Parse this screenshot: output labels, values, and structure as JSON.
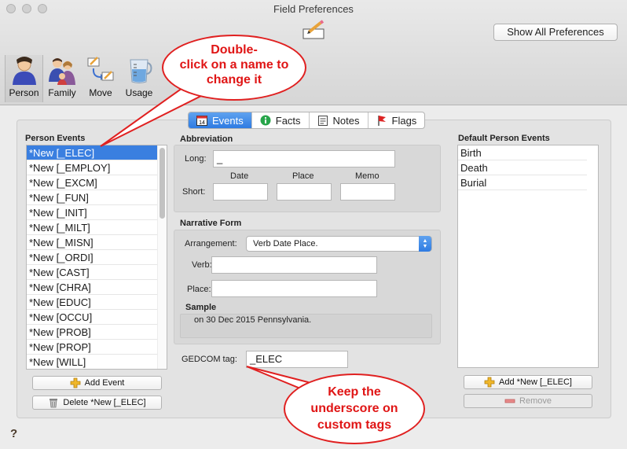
{
  "window": {
    "title": "Field Preferences",
    "show_all_label": "Show All Preferences"
  },
  "toolbar": {
    "items": [
      {
        "label": "Person",
        "icon": "person-icon",
        "selected": true
      },
      {
        "label": "Family",
        "icon": "family-icon",
        "selected": false
      },
      {
        "label": "Move",
        "icon": "move-icon",
        "selected": false
      },
      {
        "label": "Usage",
        "icon": "usage-icon",
        "selected": false
      }
    ]
  },
  "callouts": {
    "top_lines": [
      "Double-",
      "click on a name to",
      "change it"
    ],
    "bottom_lines": [
      "Keep the",
      "underscore on",
      "custom tags"
    ]
  },
  "tabs": [
    {
      "label": "Events",
      "icon": "calendar-icon",
      "active": true
    },
    {
      "label": "Facts",
      "icon": "info-icon",
      "active": false
    },
    {
      "label": "Notes",
      "icon": "notes-icon",
      "active": false
    },
    {
      "label": "Flags",
      "icon": "flag-icon",
      "active": false
    }
  ],
  "person_events": {
    "heading": "Person Events",
    "items": [
      "*New [_ELEC]",
      "*New [_EMPLOY]",
      "*New [_EXCM]",
      "*New [_FUN]",
      "*New [_INIT]",
      "*New [_MILT]",
      "*New [_MISN]",
      "*New [_ORDI]",
      "*New [CAST]",
      "*New [CHRA]",
      "*New [EDUC]",
      "*New [OCCU]",
      "*New [PROB]",
      "*New [PROP]",
      "*New [WILL]"
    ],
    "selected_index": 0,
    "add_label": "Add Event",
    "delete_label": "Delete *New [_ELEC]"
  },
  "abbreviation": {
    "heading": "Abbreviation",
    "long_label": "Long:",
    "long_value": "_",
    "short_label": "Short:",
    "date_label": "Date",
    "place_label": "Place",
    "memo_label": "Memo"
  },
  "narrative": {
    "heading": "Narrative Form",
    "arrangement_label": "Arrangement:",
    "arrangement_value": "Verb Date Place.",
    "verb_label": "Verb:",
    "place_label": "Place:",
    "sample_label": "Sample",
    "sample_text": "on 30 Dec 2015  Pennsylvania."
  },
  "gedcom": {
    "label": "GEDCOM tag:",
    "value": "_ELEC"
  },
  "default_events": {
    "heading": "Default Person Events",
    "items": [
      "Birth",
      "Death",
      "Burial"
    ],
    "add_label": "Add *New [_ELEC]",
    "remove_label": "Remove"
  },
  "help_label": "?",
  "colors": {
    "accent": "#3a7fe0",
    "callout_red": "#e01515"
  }
}
